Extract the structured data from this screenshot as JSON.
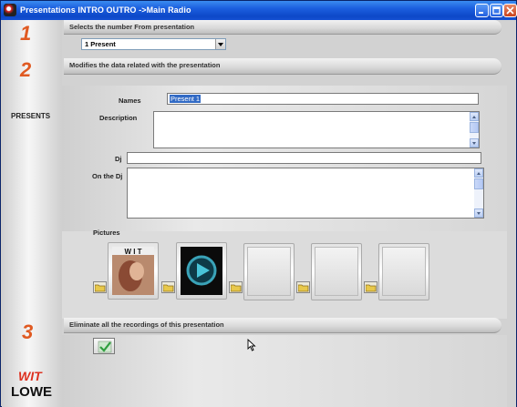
{
  "window": {
    "title": "Presentations INTRO OUTRO ->Main Radio",
    "title_color": "#ffffff",
    "titlebar_color": "#1b5ede"
  },
  "steps": {
    "one": "1",
    "two": "2",
    "three": "3"
  },
  "step_color": "#e05a22",
  "sections": {
    "select_header": "Selects the number From presentation",
    "modify_header": "Modifies the data related with the presentation",
    "eliminate_header": "Eliminate all the recordings of this presentation"
  },
  "presentation_select": {
    "value": "1 Present"
  },
  "left": {
    "presents_label": "PRESENTS",
    "logo_top": "WIT",
    "logo_bottom": "LOWE"
  },
  "form": {
    "names_label": "Names",
    "names_value": "Present 1",
    "description_label": "Description",
    "description_value": "",
    "dj_label": "Dj",
    "dj_value": "",
    "on_the_dj_label": "On the Dj",
    "on_the_dj_value": ""
  },
  "pictures": {
    "label": "Pictures",
    "slots": [
      {
        "image": "wit-album-cover",
        "empty": false,
        "cover_text": "W I T"
      },
      {
        "image": "blue-play-disc",
        "empty": false
      },
      {
        "image": "",
        "empty": true
      },
      {
        "image": "",
        "empty": true
      },
      {
        "image": "",
        "empty": true
      }
    ]
  },
  "icons": {
    "folder": "folder-icon",
    "check": "checkmark-icon",
    "cursor": "mouse-cursor-icon"
  }
}
